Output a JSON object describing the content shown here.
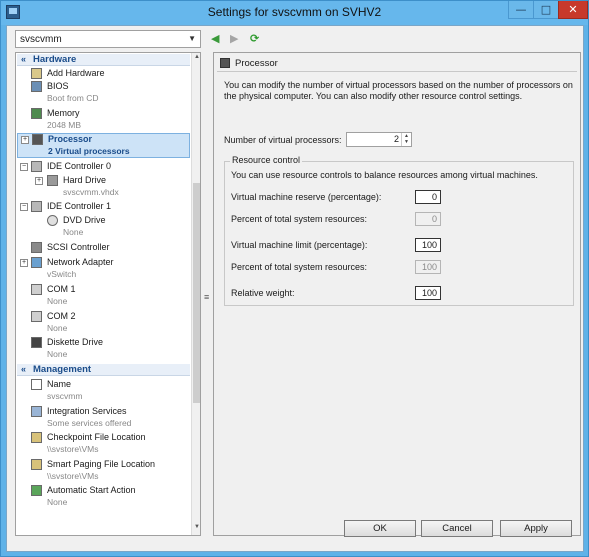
{
  "window": {
    "title": "Settings for svscvmm on SVHV2",
    "minimize_glyph": "—",
    "maximize_glyph": "□",
    "close_glyph": "✕"
  },
  "vm_selector": {
    "value": "svscvmm"
  },
  "tree": {
    "hardware_header": "Hardware",
    "management_header": "Management",
    "items": [
      {
        "label": "Add Hardware",
        "sub": ""
      },
      {
        "label": "BIOS",
        "sub": "Boot from CD"
      },
      {
        "label": "Memory",
        "sub": "2048 MB"
      },
      {
        "label": "Processor",
        "sub": "2 Virtual processors"
      },
      {
        "label": "IDE Controller 0",
        "sub": ""
      },
      {
        "label": "Hard Drive",
        "sub": "svscvmm.vhdx"
      },
      {
        "label": "IDE Controller 1",
        "sub": ""
      },
      {
        "label": "DVD Drive",
        "sub": "None"
      },
      {
        "label": "SCSI Controller",
        "sub": ""
      },
      {
        "label": "Network Adapter",
        "sub": "vSwitch"
      },
      {
        "label": "COM 1",
        "sub": "None"
      },
      {
        "label": "COM 2",
        "sub": "None"
      },
      {
        "label": "Diskette Drive",
        "sub": "None"
      }
    ],
    "management_items": [
      {
        "label": "Name",
        "sub": "svscvmm"
      },
      {
        "label": "Integration Services",
        "sub": "Some services offered"
      },
      {
        "label": "Checkpoint File Location",
        "sub": "\\\\svstore\\VMs"
      },
      {
        "label": "Smart Paging File Location",
        "sub": "\\\\svstore\\VMs"
      },
      {
        "label": "Automatic Start Action",
        "sub": "None"
      }
    ]
  },
  "processor": {
    "title": "Processor",
    "description": "You can modify the number of virtual processors based on the number of processors on the physical computer. You can also modify other resource control settings.",
    "num_label": "Number of virtual processors:",
    "num_value": "2",
    "resource_control": {
      "title": "Resource control",
      "description": "You can use resource controls to balance resources among virtual machines.",
      "reserve_label": "Virtual machine reserve (percentage):",
      "reserve_value": "0",
      "reserve_pct_label": "Percent of total system resources:",
      "reserve_pct_value": "0",
      "limit_label": "Virtual machine limit (percentage):",
      "limit_value": "100",
      "limit_pct_label": "Percent of total system resources:",
      "limit_pct_value": "100",
      "weight_label": "Relative weight:",
      "weight_value": "100"
    }
  },
  "buttons": {
    "ok": "OK",
    "cancel": "Cancel",
    "apply": "Apply"
  }
}
